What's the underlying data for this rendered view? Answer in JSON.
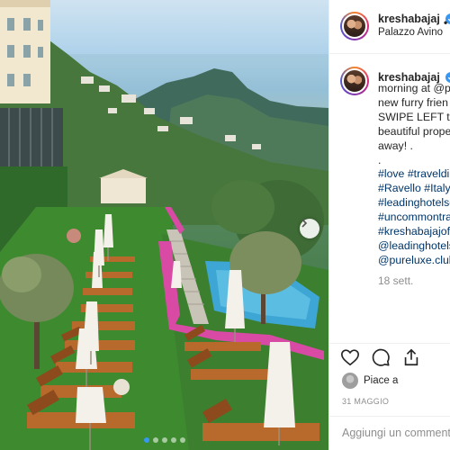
{
  "post": {
    "username": "kreshabajaj",
    "location": "Palazzo Avino",
    "header_more": "•",
    "caption_lines": [
      {
        "text": "morning at @p",
        "kind": "plain"
      },
      {
        "text": "new furry frien",
        "kind": "plain"
      },
      {
        "text": "SWIPE LEFT to s",
        "kind": "plain"
      },
      {
        "text": "beautiful prope",
        "kind": "plain"
      },
      {
        "text": "away! .",
        "kind": "plain"
      },
      {
        "text": ".",
        "kind": "plain"
      },
      {
        "text": "#love #traveldi",
        "kind": "tag"
      },
      {
        "text": "#Ravello #Italy",
        "kind": "tag"
      },
      {
        "text": "#leadinghotelsc",
        "kind": "tag"
      },
      {
        "text": "#uncommontra",
        "kind": "tag"
      },
      {
        "text": "#kreshabajajoff",
        "kind": "tag"
      },
      {
        "text": "@leadinghotels",
        "kind": "tag"
      },
      {
        "text": "@pureluxe.club",
        "kind": "tag"
      }
    ],
    "time_ago": "18 sett.",
    "likes_text": "Piace a",
    "date": "31 MAGGIO",
    "comment_placeholder": "Aggiungi un commento"
  },
  "icons": {
    "like": "heart-icon",
    "comment": "comment-icon",
    "share": "share-icon",
    "verified": "verified-badge-icon",
    "next": "chevron-right-icon"
  },
  "carousel": {
    "count": 5,
    "active": 0
  },
  "colors": {
    "accent_blue": "#3897f0",
    "hashtag": "#003569",
    "muted": "#8e8e8e",
    "border": "#efefef"
  }
}
